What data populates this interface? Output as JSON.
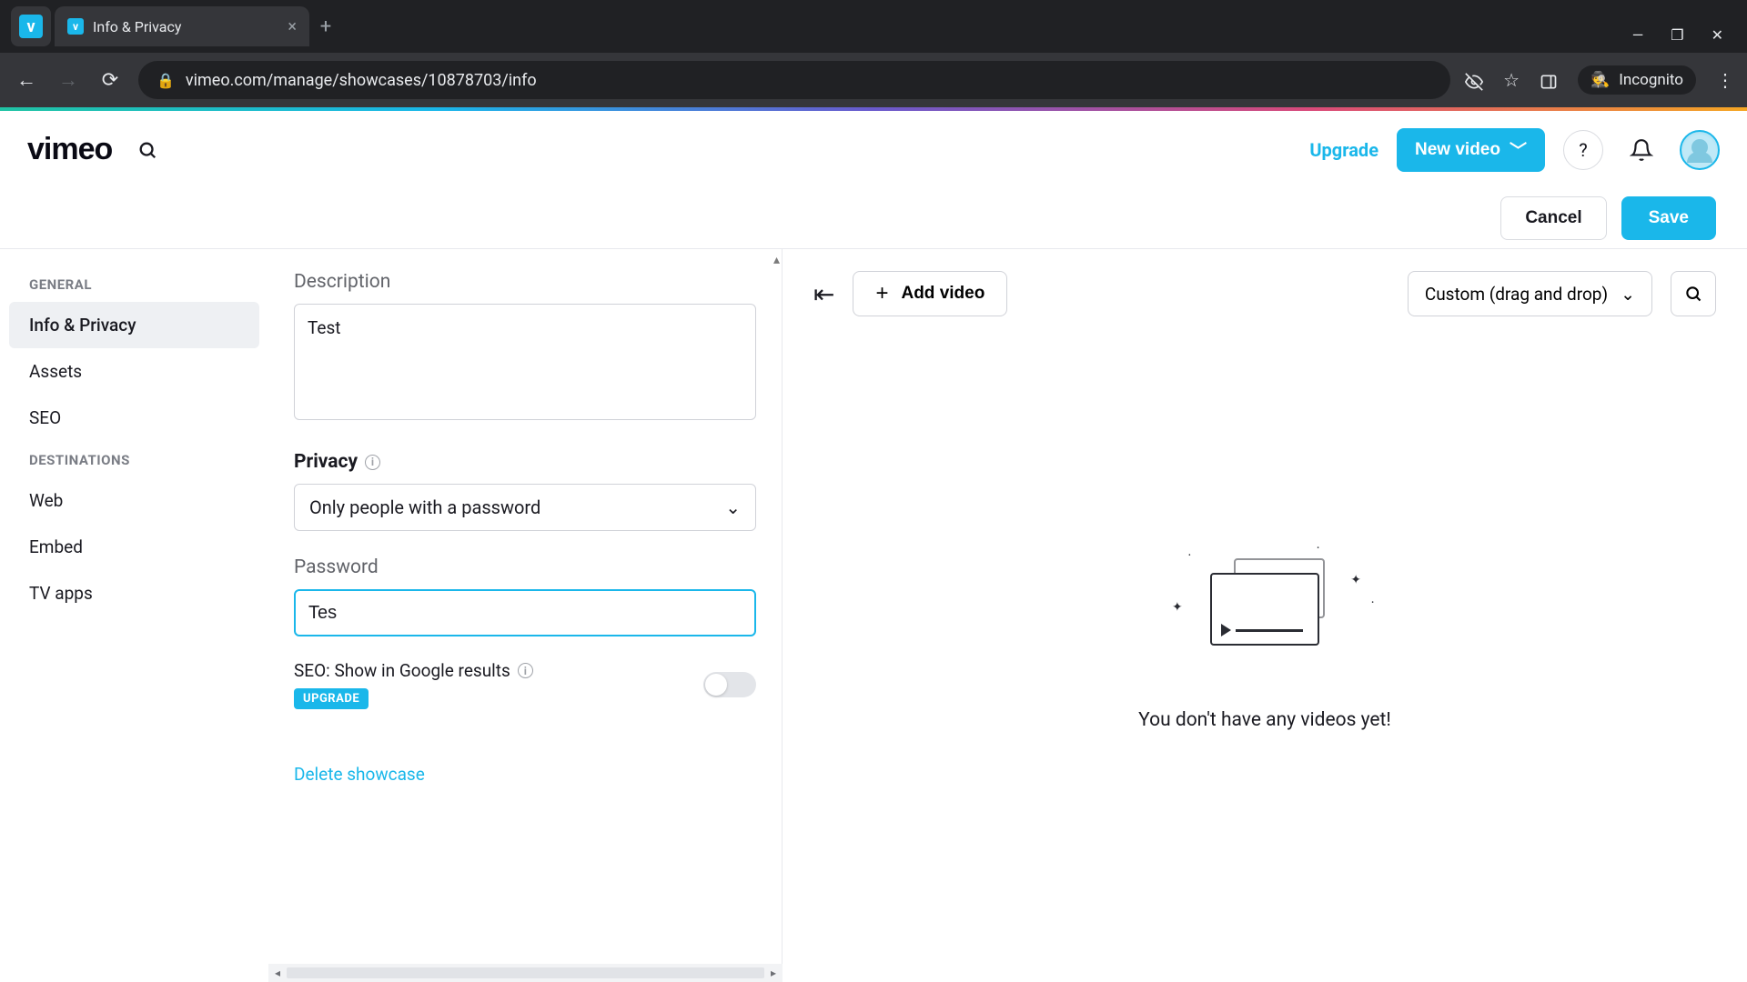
{
  "browser": {
    "tab_title": "Info & Privacy",
    "url": "vimeo.com/manage/showcases/10878703/info",
    "incognito_label": "Incognito"
  },
  "header": {
    "logo": "vimeo",
    "upgrade": "Upgrade",
    "new_video": "New video"
  },
  "actions": {
    "cancel": "Cancel",
    "save": "Save"
  },
  "sidebar": {
    "general_heading": "GENERAL",
    "destinations_heading": "DESTINATIONS",
    "items": {
      "info_privacy": "Info & Privacy",
      "assets": "Assets",
      "seo": "SEO",
      "web": "Web",
      "embed": "Embed",
      "tv_apps": "TV apps"
    }
  },
  "form": {
    "description_label": "Description",
    "description_value": "Test",
    "privacy_label": "Privacy",
    "privacy_value": "Only people with a password",
    "password_label": "Password",
    "password_value": "Tes",
    "seo_label": "SEO: Show in Google results",
    "upgrade_badge": "UPGRADE",
    "delete_link": "Delete showcase"
  },
  "preview": {
    "add_video": "Add video",
    "sort_value": "Custom (drag and drop)",
    "empty_text": "You don't have any videos yet!"
  }
}
